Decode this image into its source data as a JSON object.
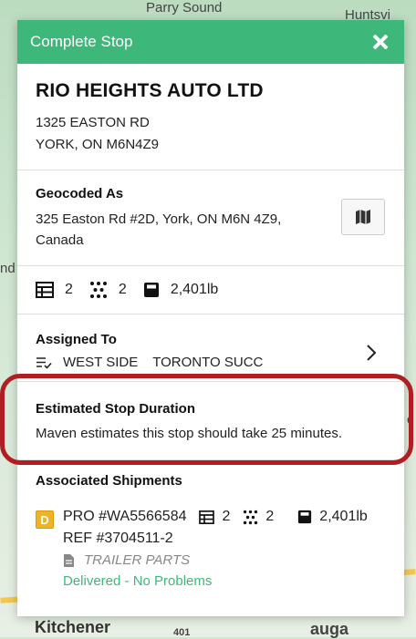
{
  "map": {
    "labels": {
      "top_left": "Parry Sound",
      "top_right": "Huntsvi",
      "left": "nd",
      "right": "c",
      "bottom": "Kitchener",
      "bottom_right": "auga",
      "road_401": "401"
    }
  },
  "header": {
    "title": "Complete Stop"
  },
  "company": {
    "name": "RIO HEIGHTS AUTO LTD",
    "address_line1": "1325 EASTON RD",
    "address_line2": "YORK, ON M6N4Z9"
  },
  "geocoded": {
    "label": "Geocoded As",
    "address_line1": "325 Easton Rd #2D, York, ON M6N 4Z9,",
    "address_line2": "Canada"
  },
  "stats": {
    "items_count": "2",
    "pallets_count": "2",
    "weight": "2,401lb"
  },
  "assigned": {
    "label": "Assigned To",
    "route": "WEST SIDE",
    "depot": "TORONTO SUCC"
  },
  "duration": {
    "label": "Estimated Stop Duration",
    "text": "Maven estimates this stop should take 25 minutes."
  },
  "shipments": {
    "label": "Associated Shipments",
    "items": [
      {
        "badge": "D",
        "pro": "PRO #WA5566584",
        "items_count": "2",
        "pallets_count": "2",
        "weight": "2,401lb",
        "ref": "REF #3704511-2",
        "description": "TRAILER PARTS",
        "status": "Delivered - No Problems"
      }
    ]
  },
  "colors": {
    "header": "#3eb87a",
    "status_ok": "#3eb87a",
    "highlight": "#b01e22",
    "badge": "#f0b324"
  }
}
